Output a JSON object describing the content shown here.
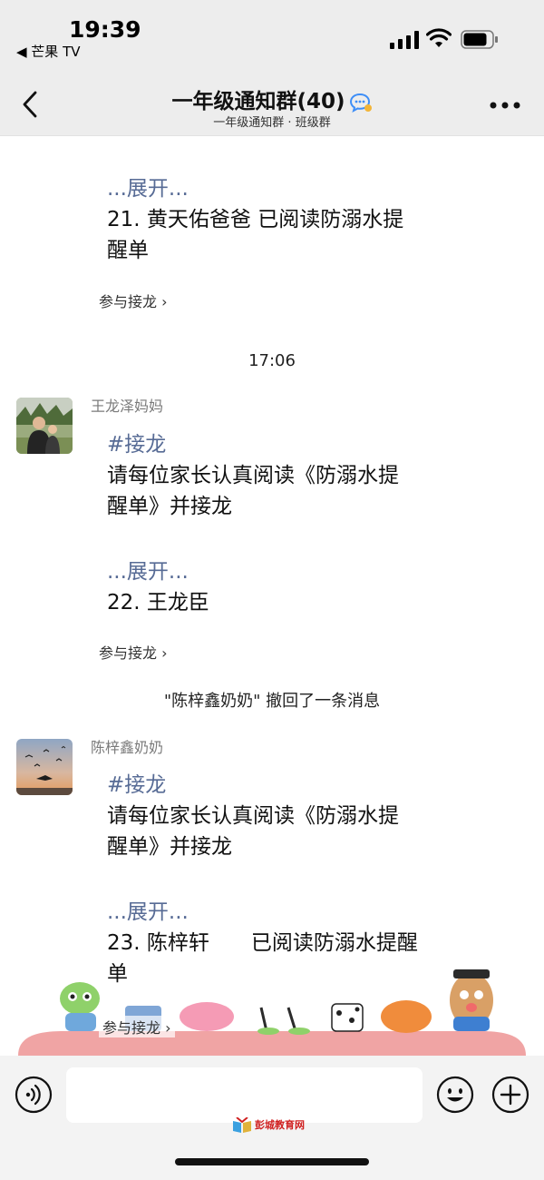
{
  "status_bar": {
    "time": "19:39",
    "back_app": "◀ 芒果 TV"
  },
  "header": {
    "title": "一年级通知群(40)",
    "subtitle": "一年级通知群 · 班级群"
  },
  "messages": {
    "first": {
      "expand": "...展开...",
      "line1": "21. 黄天佑爸爸 已阅读防溺水提",
      "line2": "醒单",
      "join": "参与接龙 ›"
    },
    "timestamp": "17:06",
    "second": {
      "sender": "王龙泽妈妈",
      "tag": "#接龙",
      "body1": "请每位家长认真阅读《防溺水提",
      "body2": "醒单》并接龙",
      "expand": "...展开...",
      "entry": "22. 王龙臣",
      "join": "参与接龙 ›"
    },
    "recall_notice": "\"陈梓鑫奶奶\" 撤回了一条消息",
    "third": {
      "sender": "陈梓鑫奶奶",
      "tag": "#接龙",
      "body1": "请每位家长认真阅读《防溺水提",
      "body2": "醒单》并接龙",
      "expand": "...展开...",
      "entry1": "23. 陈梓轩　　已阅读防溺水提醒",
      "entry2": "单",
      "join": "参与接龙 ›"
    }
  },
  "input_bar": {
    "placeholder": "",
    "watermark": "彭城教育网"
  },
  "icons": {
    "back": "chevron-left-icon",
    "more": "more-dots-icon",
    "voice": "voice-icon",
    "emoji": "emoji-icon",
    "plus": "plus-icon"
  },
  "colors": {
    "link": "#576b95",
    "nav_bg": "#ededed"
  }
}
